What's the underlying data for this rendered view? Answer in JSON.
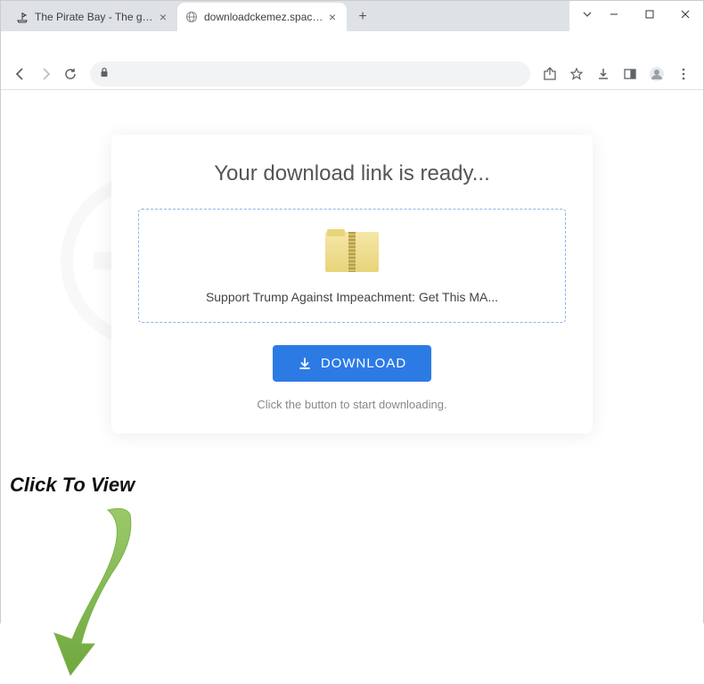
{
  "tabs": [
    {
      "title": "The Pirate Bay - The galaxy's mo…",
      "active": false
    },
    {
      "title": "downloadckemez.space/9/?7fk8…",
      "active": true
    }
  ],
  "card": {
    "title": "Your download link is ready...",
    "file_name": "Support Trump Against Impeachment: Get This MA...",
    "download_label": "DOWNLOAD",
    "hint": "Click the button to start downloading."
  },
  "overlay_text": "Click To View",
  "colors": {
    "primary_button": "#2c7be5"
  }
}
